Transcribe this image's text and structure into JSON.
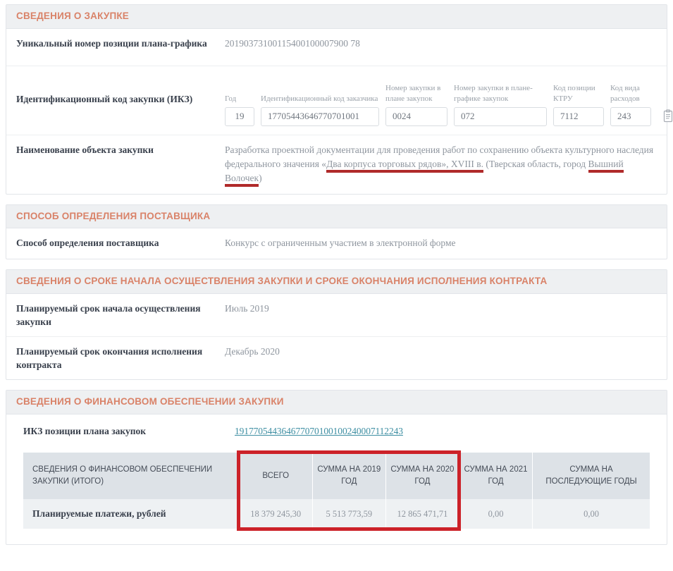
{
  "sections": {
    "procurement": {
      "title": "СВЕДЕНИЯ О ЗАКУПКЕ",
      "unique_number_label": "Уникальный номер позиции плана-графика",
      "unique_number_value": "20190373100115400100007900 78",
      "ikz_label": "Идентификационный код закупки (ИКЗ)",
      "ikz_fields": [
        {
          "caption": "Год",
          "value": "19"
        },
        {
          "caption": "Идентификационный код заказчика",
          "value": "17705443646770701001"
        },
        {
          "caption": "Номер закупки в плане закупок",
          "value": "0024"
        },
        {
          "caption": "Номер закупки в плане-графике закупок",
          "value": "072"
        },
        {
          "caption": "Код позиции КТРУ",
          "value": "7112"
        },
        {
          "caption": "Код вида расходов",
          "value": "243"
        }
      ],
      "copy_icon": "clipboard-copy-icon",
      "object_name_label": "Наименование объекта закупки",
      "object_name_part1": "Разработка проектной документации для проведения работ по сохранению объекта культурного наследия федерального значения «",
      "object_name_highlight1": "Два корпуса торговых рядов», XVIII в.",
      "object_name_part2": " (Тверская область, город ",
      "object_name_highlight2": "Вышний Волочек",
      "object_name_part3": ")"
    },
    "supplier_method": {
      "title": "СПОСОБ ОПРЕДЕЛЕНИЯ ПОСТАВЩИКА",
      "label": "Способ определения поставщика",
      "value": "Конкурс с ограниченным участием в электронной форме"
    },
    "terms": {
      "title": "СВЕДЕНИЯ О СРОКЕ НАЧАЛА ОСУЩЕСТВЛЕНИЯ ЗАКУПКИ И СРОКЕ ОКОНЧАНИЯ ИСПОЛНЕНИЯ КОНТРАКТА",
      "rows": [
        {
          "label": "Планируемый срок начала осуществления закупки",
          "value": "Июль 2019"
        },
        {
          "label": "Планируемый срок окончания исполнения контракта",
          "value": "Декабрь 2020"
        }
      ]
    },
    "financing": {
      "title": "СВЕДЕНИЯ О ФИНАНСОВОМ ОБЕСПЕЧЕНИИ ЗАКУПКИ",
      "ikz_plan_label": "ИКЗ позиции плана закупок",
      "ikz_plan_link": "191770544364677070100100240007112243",
      "table": {
        "corner_header": "СВЕДЕНИЯ О ФИНАНСОВОМ ОБЕСПЕЧЕНИИ ЗАКУПКИ (ИТОГО)",
        "headers": [
          "ВСЕГО",
          "СУММА НА 2019 ГОД",
          "СУММА НА 2020 ГОД",
          "СУММА НА 2021 ГОД",
          "СУММА НА ПОСЛЕДУЮЩИЕ ГОДЫ"
        ],
        "row_label": "Планируемые платежи, рублей",
        "values": [
          "18 379 245,30",
          "5 513 773,59",
          "12 865 471,71",
          "0,00",
          "0,00"
        ]
      }
    }
  },
  "chart_data": {
    "type": "table",
    "title": "СВЕДЕНИЯ О ФИНАНСОВОМ ОБЕСПЕЧЕНИИ ЗАКУПКИ (ИТОГО)",
    "categories": [
      "ВСЕГО",
      "СУММА НА 2019 ГОД",
      "СУММА НА 2020 ГОД",
      "СУММА НА 2021 ГОД",
      "СУММА НА ПОСЛЕДУЮЩИЕ ГОДЫ"
    ],
    "series": [
      {
        "name": "Планируемые платежи, рублей",
        "values": [
          18379245.3,
          5513773.59,
          12865471.71,
          0.0,
          0.0
        ]
      }
    ],
    "ylabel": "рублей",
    "annotations": [
      {
        "type": "highlight-box",
        "color": "#cc2229",
        "covers": [
          "ВСЕГО",
          "СУММА НА 2019 ГОД",
          "СУММА НА 2020 ГОД"
        ]
      }
    ]
  },
  "colors": {
    "section_title": "#d98268",
    "annotation_box": "#cc2229",
    "annotation_underline": "#b02a2a",
    "link": "#3f8fa3",
    "table_header_bg": "#dde2e7",
    "table_row_bg": "#eef1f3"
  }
}
